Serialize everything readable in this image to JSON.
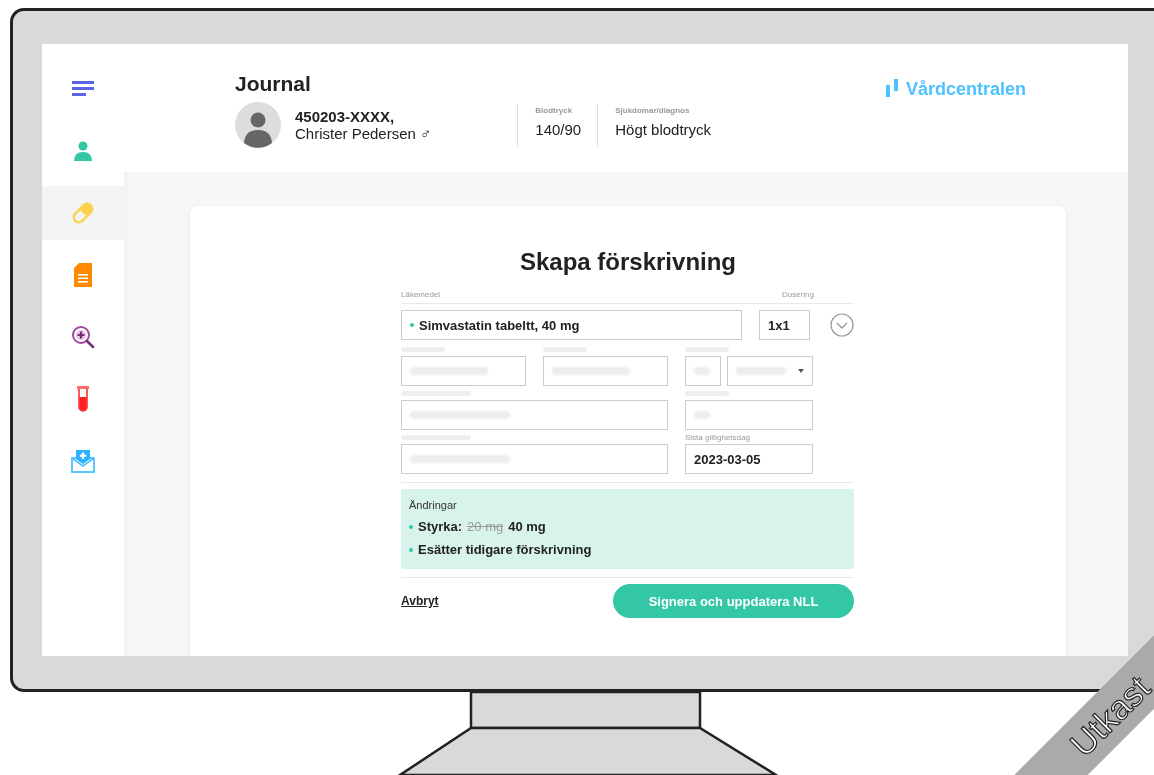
{
  "sidebar": {
    "items": [
      {
        "kind": "menu",
        "selected": false
      },
      {
        "kind": "patient",
        "selected": false
      },
      {
        "kind": "medication",
        "selected": true
      },
      {
        "kind": "document",
        "selected": false
      },
      {
        "kind": "lab-search",
        "selected": false
      },
      {
        "kind": "test-tube",
        "selected": false
      },
      {
        "kind": "mail",
        "selected": false
      }
    ]
  },
  "header": {
    "title": "Journal",
    "patient_id": "450203-XXXX,",
    "patient_name": "Christer Pedersen ♂",
    "stats": [
      {
        "label": "Blodtryck",
        "value": "140/90"
      },
      {
        "label": "Sjukdomar/diagnos",
        "value": "Högt blodtryck"
      }
    ],
    "brand": "Vårdcentralen"
  },
  "form": {
    "title": "Skapa förskrivning",
    "medication_label": "Läkemedel",
    "dosage_label": "Dosering",
    "medication": "Simvastatin tabeltt, 40 mg",
    "dosage": "1x1",
    "expiry_label": "Sista giltighetsdag",
    "expiry": "2023-03-05",
    "changes": {
      "heading": "Ändringar",
      "items": [
        {
          "kind": "strength",
          "label": "Styrka:",
          "old": "20 mg",
          "new": "40 mg"
        },
        {
          "kind": "note",
          "text": "Esätter tidigare förskrivning"
        }
      ]
    },
    "cancel": "Avbryt",
    "submit": "Signera och uppdatera NLL"
  },
  "ribbon": "Utkast"
}
